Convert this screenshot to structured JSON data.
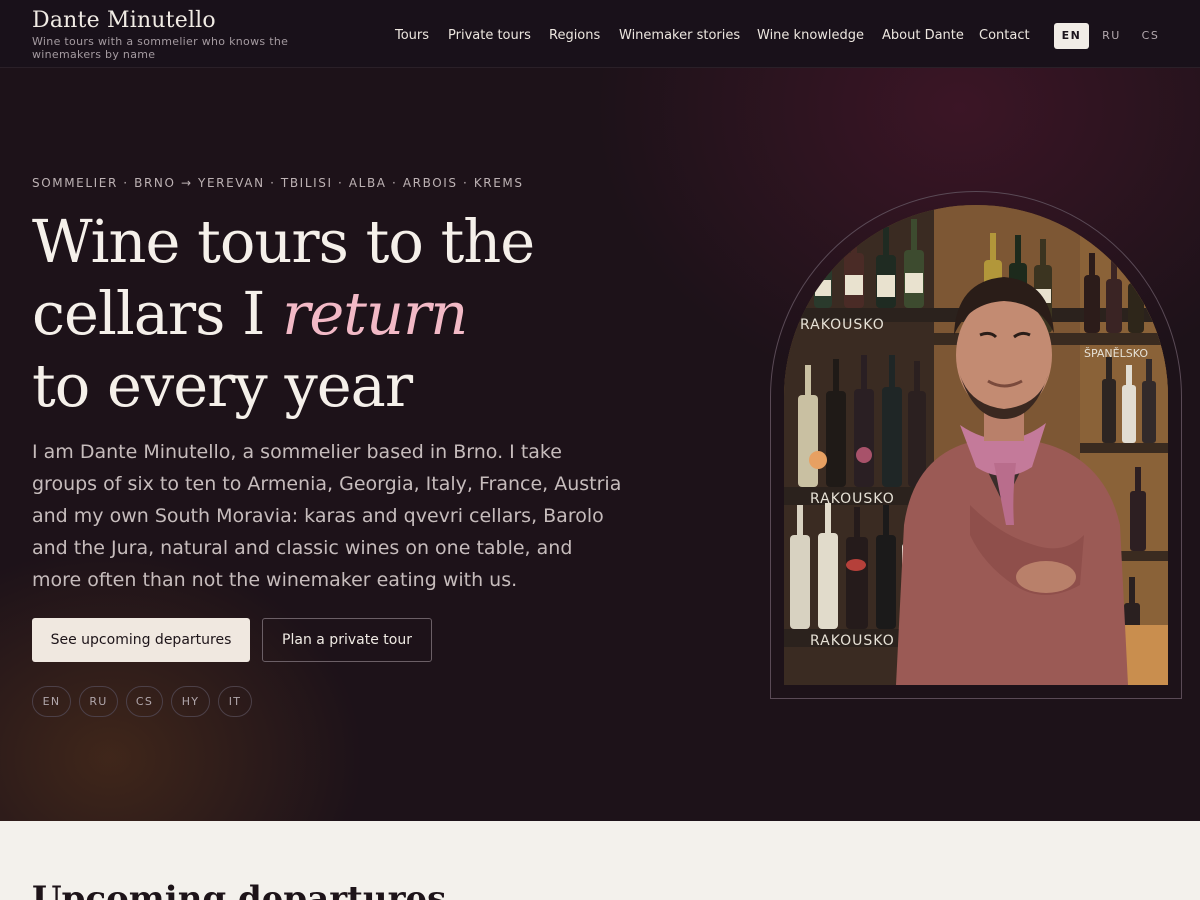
{
  "brand": {
    "name": "Dante Minutello",
    "tagline": "Wine tours with a sommelier who knows the winemakers by name"
  },
  "nav": {
    "items": [
      "Tours",
      "Private tours",
      "Regions",
      "Winemaker stories",
      "Wine knowledge",
      "About Dante",
      "Contact"
    ]
  },
  "language_switch": {
    "options": [
      "EN",
      "RU",
      "CS"
    ],
    "selected": "EN"
  },
  "hero": {
    "eyebrow": "SOMMELIER · BRNO → YEREVAN · TBILISI · ALBA · ARBOIS · KREMS",
    "headline": {
      "line1": "Wine tours to the",
      "line2_before": "cellars I ",
      "line2_emphasis": "return",
      "line3": "to every year"
    },
    "intro": "I am Dante Minutello, a sommelier based in Brno. I take groups of six to ten to Armenia, Georgia, Italy, France, Austria and my own South Moravia: karas and qvevri cellars, Barolo and the Jura, natural and classic wines on one table, and more often than not the winemaker eating with us.",
    "primary_cta": "See upcoming departures",
    "secondary_cta": "Plan a private tour",
    "tour_languages": [
      "EN",
      "RU",
      "CS",
      "HY",
      "IT"
    ],
    "photo_labels": [
      "RAKOUSKO",
      "ŠPANĚLSKO",
      "RAKOUSKO",
      "RAKOUSKO"
    ]
  },
  "next_section": {
    "title": "Upcoming departures"
  },
  "colors": {
    "header_bg": "#19111a",
    "hero_bg": "#1d1219",
    "accent_pink": "#f2b9c6",
    "cta_bg": "#f0e8e0",
    "section_bg": "#f3f1ec"
  }
}
